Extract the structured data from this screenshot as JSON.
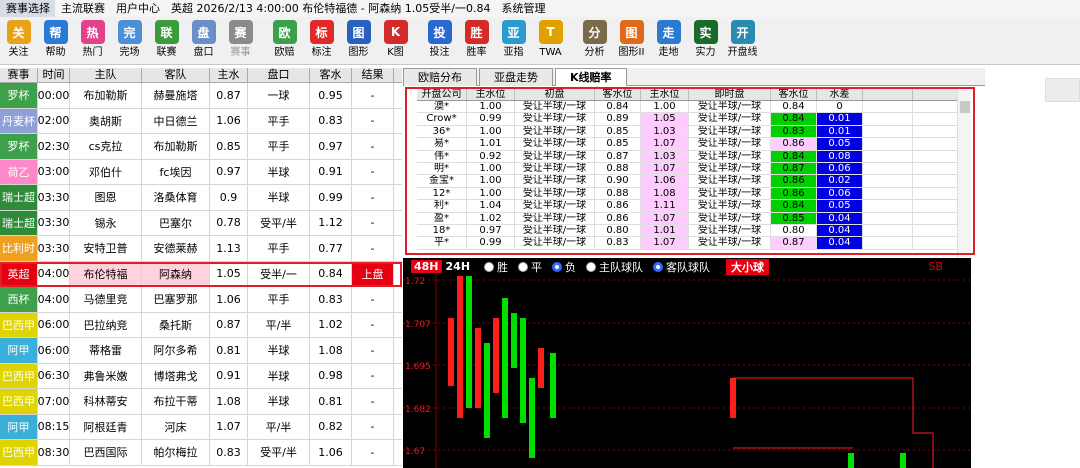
{
  "menu": [
    "赛事选择",
    "主流联赛",
    "用户中心",
    "英超 2026/2/13 4:00:00 布伦特福德 - 阿森纳 1.05受半/一0.84",
    "系统管理"
  ],
  "toolbar": [
    {
      "label": "关注",
      "icon": "trophy-icon",
      "color": "#e8a21a"
    },
    {
      "label": "帮助",
      "icon": "help-icon",
      "color": "#2b7bd6"
    },
    {
      "label": "热门",
      "icon": "heart-icon",
      "color": "#e2418c"
    },
    {
      "label": "完场",
      "icon": "search-icon",
      "color": "#4a8fd8"
    },
    {
      "label": "联赛",
      "icon": "zoom-icon",
      "color": "#3a9b3a"
    },
    {
      "label": "盘口",
      "icon": "zoom-in-icon",
      "color": "#6a8fc8"
    },
    {
      "label": "赛事",
      "icon": "grid-icon",
      "color": "#8a8a8a",
      "disabled": true
    },
    {
      "label": "欧赔",
      "icon": "chart-icon",
      "color": "#3aa04a"
    },
    {
      "label": "标注",
      "icon": "heart-red-icon",
      "color": "#e02a2a"
    },
    {
      "label": "图形",
      "icon": "graph-icon",
      "color": "#2a60c0"
    },
    {
      "label": "K图",
      "icon": "k-chart-icon",
      "color": "#d42a2a"
    },
    {
      "label": "投注",
      "icon": "bet-icon",
      "color": "#2a6ad0"
    },
    {
      "label": "胜率",
      "icon": "win-rate-icon",
      "color": "#d42a2a"
    },
    {
      "label": "亚指",
      "icon": "globe-icon",
      "color": "#2a9ad0"
    },
    {
      "label": "TWA",
      "icon": "twa-icon",
      "color": "#e0a000"
    },
    {
      "label": "分析",
      "icon": "clipboard-icon",
      "color": "#7a6a4a"
    },
    {
      "label": "图形II",
      "icon": "graph-ii-icon",
      "color": "#e06a1a"
    },
    {
      "label": "走地",
      "icon": "live-icon",
      "color": "#2a7ad0"
    },
    {
      "label": "实力",
      "icon": "strength-icon",
      "color": "#1a6a2a"
    },
    {
      "label": "开盘线",
      "icon": "open-line-icon",
      "color": "#2a8ab0"
    }
  ],
  "matches": {
    "headers": [
      "赛事",
      "时间",
      "主队",
      "客队",
      "主水",
      "盘口",
      "客水",
      "结果"
    ],
    "rows": [
      {
        "league": "罗杯",
        "color": "#3ea04a",
        "time": "00:00",
        "home": "布加勒斯",
        "away": "赫曼施塔",
        "hw": "0.87",
        "hc": "一球",
        "aw": "0.95",
        "res": "-"
      },
      {
        "league": "丹麦杯",
        "color": "#8fa0d8",
        "time": "02:00",
        "home": "奥胡斯",
        "away": "中日德兰",
        "hw": "1.06",
        "hc": "平手",
        "aw": "0.83",
        "res": "-"
      },
      {
        "league": "罗杯",
        "color": "#3ea04a",
        "time": "02:30",
        "home": "cs克拉",
        "away": "布加勒斯",
        "hw": "0.85",
        "hc": "平手",
        "aw": "0.97",
        "res": "-"
      },
      {
        "league": "荷乙",
        "color": "#ff88c8",
        "time": "03:00",
        "home": "邓伯什",
        "away": "fc埃因",
        "hw": "0.97",
        "hc": "半球",
        "aw": "0.91",
        "res": "-"
      },
      {
        "league": "瑞士超",
        "color": "#2e8b3a",
        "time": "03:30",
        "home": "图恩",
        "away": "洛桑体育",
        "hw": "0.9",
        "hc": "半球",
        "aw": "0.99",
        "res": "-"
      },
      {
        "league": "瑞士超",
        "color": "#2e8b3a",
        "time": "03:30",
        "home": "锡永",
        "away": "巴塞尔",
        "hw": "0.78",
        "hc": "受平/半",
        "aw": "1.12",
        "res": "-"
      },
      {
        "league": "比利时",
        "color": "#f0a020",
        "time": "03:30",
        "home": "安特卫普",
        "away": "安德莱赫",
        "hw": "1.13",
        "hc": "平手",
        "aw": "0.77",
        "res": "-"
      },
      {
        "league": "英超",
        "color": "#e60012",
        "time": "04:00",
        "home": "布伦特福",
        "away": "阿森纳",
        "hw": "1.05",
        "hc": "受半/一",
        "aw": "0.84",
        "res": "上盘",
        "sel": true
      },
      {
        "league": "西杯",
        "color": "#3ea04a",
        "time": "04:00",
        "home": "马德里竞",
        "away": "巴塞罗那",
        "hw": "1.06",
        "hc": "平手",
        "aw": "0.83",
        "res": "-"
      },
      {
        "league": "巴西甲",
        "color": "#e0d400",
        "time": "06:00",
        "home": "巴拉纳竞",
        "away": "桑托斯",
        "hw": "0.87",
        "hc": "平/半",
        "aw": "1.02",
        "res": "-"
      },
      {
        "league": "阿甲",
        "color": "#3ab0d8",
        "time": "06:00",
        "home": "蒂格雷",
        "away": "阿尔多希",
        "hw": "0.81",
        "hc": "半球",
        "aw": "1.08",
        "res": "-"
      },
      {
        "league": "巴西甲",
        "color": "#e0d400",
        "time": "06:30",
        "home": "弗鲁米嫩",
        "away": "博塔弗戈",
        "hw": "0.91",
        "hc": "半球",
        "aw": "0.98",
        "res": "-"
      },
      {
        "league": "巴西甲",
        "color": "#e0d400",
        "time": "07:00",
        "home": "科林蒂安",
        "away": "布拉干蒂",
        "hw": "1.08",
        "hc": "半球",
        "aw": "0.81",
        "res": "-"
      },
      {
        "league": "阿甲",
        "color": "#3ab0d8",
        "time": "08:15",
        "home": "阿根廷青",
        "away": "河床",
        "hw": "1.07",
        "hc": "平/半",
        "aw": "0.82",
        "res": "-"
      },
      {
        "league": "巴西甲",
        "color": "#e0d400",
        "time": "08:30",
        "home": "巴西国际",
        "away": "帕尔梅拉",
        "hw": "0.83",
        "hc": "受平/半",
        "aw": "1.06",
        "res": "-"
      }
    ]
  },
  "tabs": [
    "欧赔分布",
    "亚盘走势",
    "K线赔率"
  ],
  "odds": {
    "headers": [
      "开盘公司",
      "主水位",
      "初盘",
      "客水位",
      "主水位",
      "即时盘",
      "客水位",
      "水差"
    ],
    "rows": [
      {
        "co": "澳*",
        "h1": "1.00",
        "l1": "受让半球/一球",
        "a1": "0.84",
        "h2": "1.00",
        "l2": "受让半球/一球",
        "a2": "0.84",
        "d": "0",
        "cls": ""
      },
      {
        "co": "Crow*",
        "h1": "0.99",
        "l1": "受让半球/一球",
        "a1": "0.89",
        "h2": "1.05",
        "l2": "受让半球/一球",
        "a2": "0.84",
        "d": "0.01",
        "cls": "pk gr"
      },
      {
        "co": "36*",
        "h1": "1.00",
        "l1": "受让半球/一球",
        "a1": "0.85",
        "h2": "1.03",
        "l2": "受让半球/一球",
        "a2": "0.83",
        "d": "0.01",
        "cls": "pk gr"
      },
      {
        "co": "易*",
        "h1": "1.01",
        "l1": "受让半球/一球",
        "a1": "0.85",
        "h2": "1.07",
        "l2": "受让半球/一球",
        "a2": "0.86",
        "d": "0.05",
        "cls": "pk pk"
      },
      {
        "co": "伟*",
        "h1": "0.92",
        "l1": "受让半球/一球",
        "a1": "0.87",
        "h2": "1.03",
        "l2": "受让半球/一球",
        "a2": "0.84",
        "d": "0.08",
        "cls": "pk gr"
      },
      {
        "co": "明*",
        "h1": "1.00",
        "l1": "受让半球/一球",
        "a1": "0.88",
        "h2": "1.07",
        "l2": "受让半球/一球",
        "a2": "0.87",
        "d": "0.06",
        "cls": "pk gr"
      },
      {
        "co": "金宝*",
        "h1": "1.00",
        "l1": "受让半球/一球",
        "a1": "0.90",
        "h2": "1.06",
        "l2": "受让半球/一球",
        "a2": "0.86",
        "d": "0.02",
        "cls": "pk gr"
      },
      {
        "co": "12*",
        "h1": "1.00",
        "l1": "受让半球/一球",
        "a1": "0.88",
        "h2": "1.08",
        "l2": "受让半球/一球",
        "a2": "0.86",
        "d": "0.06",
        "cls": "pk gr"
      },
      {
        "co": "利*",
        "h1": "1.04",
        "l1": "受让半球/一球",
        "a1": "0.86",
        "h2": "1.11",
        "l2": "受让半球/一球",
        "a2": "0.84",
        "d": "0.05",
        "cls": "pk gr"
      },
      {
        "co": "盈*",
        "h1": "1.02",
        "l1": "受让半球/一球",
        "a1": "0.86",
        "h2": "1.07",
        "l2": "受让半球/一球",
        "a2": "0.85",
        "d": "0.04",
        "cls": "pk gr"
      },
      {
        "co": "18*",
        "h1": "0.97",
        "l1": "受让半球/一球",
        "a1": "0.80",
        "h2": "1.01",
        "l2": "受让半球/一球",
        "a2": "0.80",
        "d": "0.04",
        "cls": "pk none"
      },
      {
        "co": "平*",
        "h1": "0.99",
        "l1": "受让半球/一球",
        "a1": "0.83",
        "h2": "1.07",
        "l2": "受让半球/一球",
        "a2": "0.87",
        "d": "0.04",
        "cls": "pk pk"
      }
    ]
  },
  "chartbar": {
    "h48": "48H",
    "h24": "24H",
    "opts": [
      "胜",
      "平",
      "负",
      "主队球队",
      "客队球队"
    ],
    "selected": [
      2,
      4
    ],
    "dxq": "大小球",
    "sb": "SB"
  },
  "chart_data": {
    "type": "candlestick",
    "yticks": [
      "1.72",
      "1.707",
      "1.695",
      "1.682",
      "1.67"
    ],
    "ylim": [
      1.665,
      1.725
    ]
  },
  "colors": {
    "up": "#00e000",
    "down": "#ff1e1e",
    "accent": "#e21d26"
  }
}
